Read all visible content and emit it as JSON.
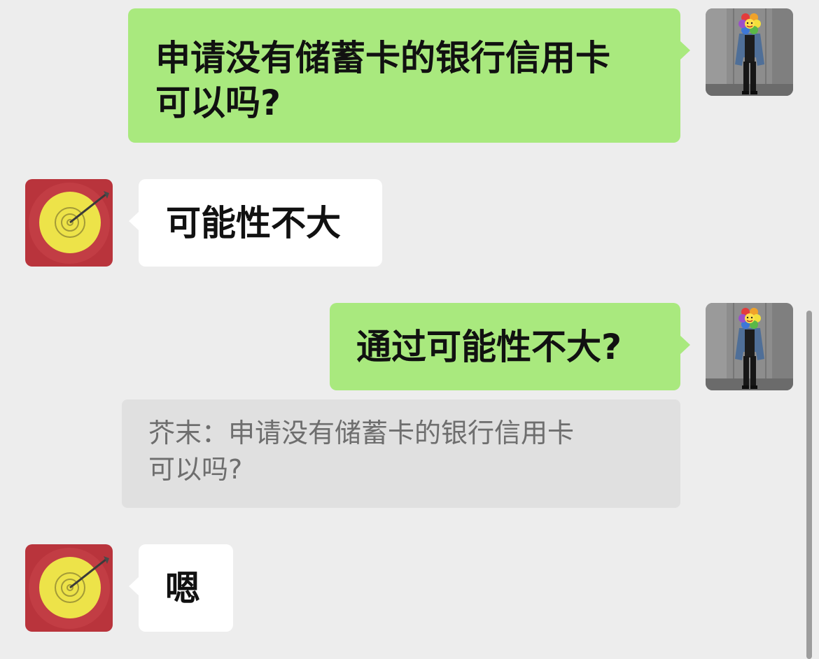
{
  "conversation": {
    "messages": [
      {
        "sender": "self",
        "text": "申请没有储蓄卡的银行信用卡\n可以吗?"
      },
      {
        "sender": "other",
        "text": "可能性不大"
      },
      {
        "sender": "self",
        "text": "通过可能性不大?",
        "quote": "芥末：申请没有储蓄卡的银行信用卡\n可以吗?"
      },
      {
        "sender": "other",
        "text": "嗯"
      }
    ]
  },
  "colors": {
    "background": "#ededed",
    "self_bubble": "#a9e97e",
    "other_bubble": "#ffffff",
    "quote_bg": "#e0e0e0",
    "quote_text": "#6e6e6e"
  },
  "icons": {
    "self_avatar": "person-photo-avatar",
    "other_avatar": "archery-target-avatar"
  }
}
